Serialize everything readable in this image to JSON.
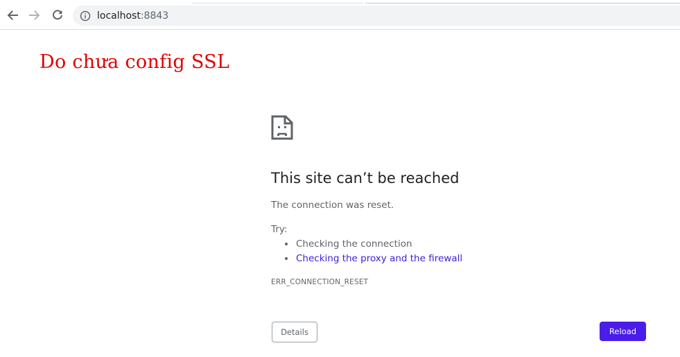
{
  "browser": {
    "url_host": "localhost",
    "url_port": ":8843",
    "icons": {
      "back": "arrow-left-icon",
      "forward": "arrow-right-icon",
      "reload": "reload-icon",
      "site_info": "info-circle-icon"
    }
  },
  "annotation": {
    "text": "Do chưa config SSL",
    "color": "#e00000"
  },
  "error_page": {
    "icon": "sad-document-icon",
    "title": "This site can’t be reached",
    "message": "The connection was reset.",
    "try_label": "Try:",
    "suggestions": [
      {
        "text": "Checking the connection",
        "is_link": false
      },
      {
        "text": "Checking the proxy and the firewall",
        "is_link": true
      }
    ],
    "error_code": "ERR_CONNECTION_RESET",
    "details_button": "Details",
    "reload_button": "Reload",
    "colors": {
      "link": "#3c1fd8",
      "primary_button": "#4a1de8"
    }
  }
}
